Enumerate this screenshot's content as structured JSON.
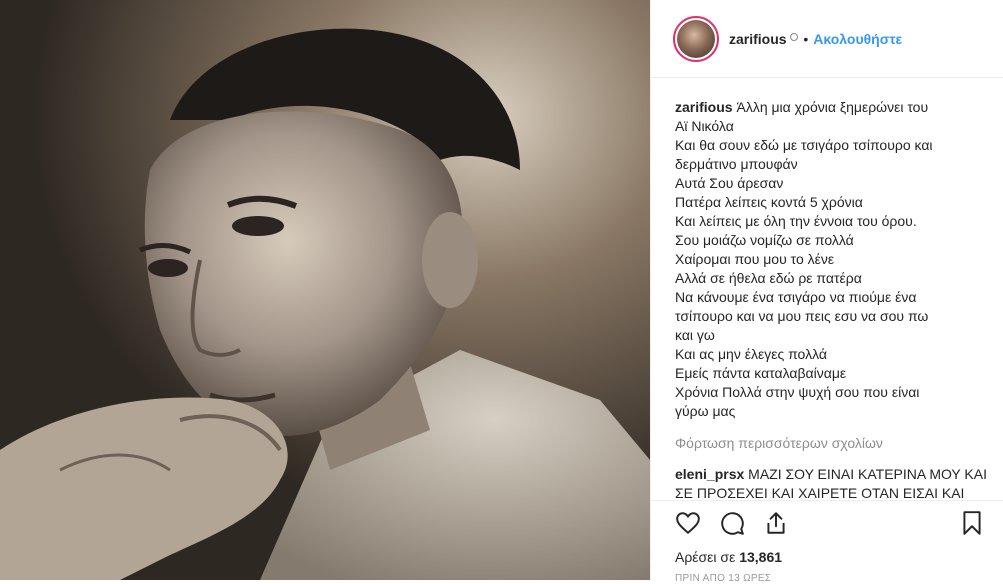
{
  "post": {
    "username": "zarifious",
    "verified_glyph": "⭘",
    "separator": "•",
    "follow_label": "Ακολουθήστε"
  },
  "caption": {
    "username": "zarifious",
    "lines": [
      "Άλλη μια χρόνια ξημερώνει του",
      "Αϊ Νικόλα",
      "Και θα σουν εδώ με τσιγάρο τσίπουρο και",
      "δερμάτινο μπουφάν",
      "Αυτά Σου άρεσαν",
      "Πατέρα λείπεις κοντά 5 χρόνια",
      "Και λείπεις με όλη την έννοια του όρου.",
      "Σου μοιάζω νομίζω σε πολλά",
      "Χαίρομαι που μου το λένε",
      "Αλλά σε ήθελα εδώ ρε πατέρα",
      "Να κάνουμε ένα τσιγάρο να πιούμε ένα",
      "τσίπουρο και να μου πεις εσυ να σου πω",
      "και γω",
      "Και ας μην έλεγες πολλά",
      "Εμείς πάντα καταλαβαίναμε",
      "Χρόνια Πολλά στην ψυχή σου που είναι",
      "γύρω μας"
    ]
  },
  "load_more_label": "Φόρτωση περισσότερων σχολίων",
  "comment": {
    "username": "eleni_prsx",
    "text": "ΜΑΖΙ ΣΟΥ ΕΙΝΑΙ ΚΑΤΕΡΙΝΑ ΜΟΥ ΚΑΙ ΣΕ ΠΡΟΣΕΧΕΙ ΚΑΙ ΧΑΙΡΕΤΕ ΟΤΑΝ ΕΙΣΑΙ ΚΑΙ ΣΤΕΝΑΧΩΡΙΕΜΑΙ ΟΤΑΝ ΕΙΣΑΙ"
  },
  "actions": {
    "like_icon": "heart-icon",
    "comment_icon": "comment-icon",
    "share_icon": "share-icon",
    "save_icon": "bookmark-icon"
  },
  "likes": {
    "prefix": "Αρέσει σε",
    "count": "13,861"
  },
  "timestamp": "ΠΡΙΝ ΑΠΟ 13 ΩΡΕΣ",
  "colors": {
    "link": "#3897f0",
    "text": "#262626",
    "muted": "#8e8e8e"
  }
}
